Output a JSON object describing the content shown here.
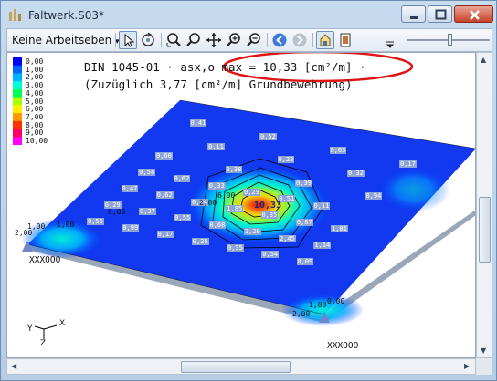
{
  "window": {
    "title": "Faltwerk.S03*"
  },
  "toolbar": {
    "combo_label": "Keine Arbeitseben",
    "combo_arrow": "▾",
    "icons": [
      "select-arrow-icon",
      "rotate-view-icon",
      "zoom-window-icon",
      "zoom-icon",
      "pan-icon",
      "zoom-in-icon",
      "zoom-out-icon",
      "back-nav-icon",
      "forward-nav-icon",
      "hide-elements-icon",
      "page-view-icon"
    ]
  },
  "legend": {
    "values": [
      "0,00",
      "1,00",
      "2,00",
      "3,00",
      "4,00",
      "5,00",
      "6,00",
      "7,00",
      "8,00",
      "9,00",
      "10,00"
    ],
    "colors": [
      "#0000ff",
      "#0066ff",
      "#00b3ff",
      "#00ffd5",
      "#00ff55",
      "#aaff00",
      "#ffee00",
      "#ff9900",
      "#ff3300",
      "#ff0066",
      "#ff00ff"
    ]
  },
  "heading": {
    "line1": "DIN 1045-01 · asx,o max = 10,33 [cm²/m] ·",
    "line2": "(Zuzüglich 3,77 [cm²/m] Grundbewehrung)"
  },
  "plot": {
    "peak_label": "10,33",
    "contour_labels": [
      "2,00",
      "1,00",
      "0,00",
      "1,00",
      "2,00",
      "0,00",
      "1,00",
      "2,00",
      "6,00"
    ],
    "value_labels": [
      "0,56",
      "0,99",
      "0,17",
      "0,25",
      "0,35",
      "0,54",
      "0,09",
      "0,29",
      "0,37",
      "0,55",
      "0,68",
      "1,20",
      "2,45",
      "1,14",
      "0,47",
      "0,62",
      "0,74",
      "1,85",
      "0,35",
      "0,87",
      "1,01",
      "0,58",
      "0,62",
      "0,33",
      "0,29",
      "0,51",
      "0,11",
      "0,60",
      "0,38",
      "0,39",
      "0,94",
      "0,11",
      "0,23",
      "0,32",
      "0,41",
      "0,52",
      "0,63",
      "0,17",
      "0,21",
      "0,26",
      "0,22",
      "0,09",
      "0,14",
      "0,35",
      "0,24",
      "0,18",
      "0,30",
      "0,54",
      "0,28",
      "0,04",
      "0,17",
      "1,31"
    ],
    "support_label_left": "XXXOOO",
    "support_label_right": "XXXOOO"
  },
  "axes": {
    "y": "Y",
    "x": "X",
    "z": "Z"
  }
}
